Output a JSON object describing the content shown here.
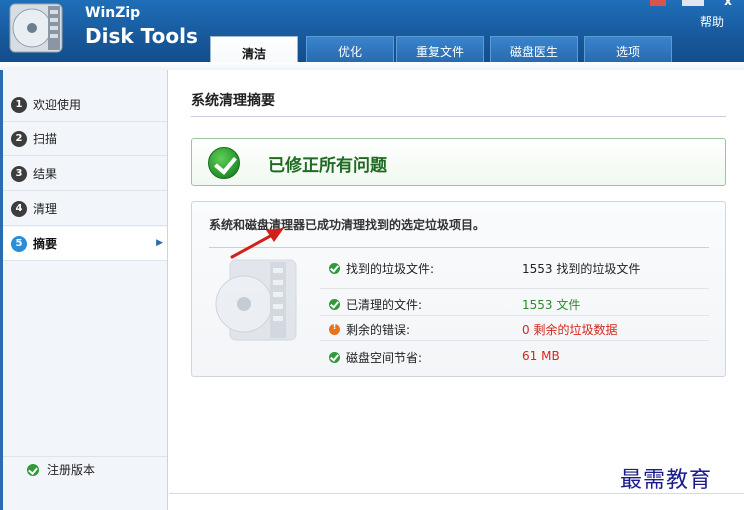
{
  "app": {
    "brand_top": "WinZip",
    "brand_main": "Disk Tools",
    "help_label": "帮助",
    "close_glyph": "x"
  },
  "tabs": [
    {
      "label": "清洁",
      "active": true
    },
    {
      "label": "优化",
      "active": false
    },
    {
      "label": "重复文件",
      "active": false
    },
    {
      "label": "磁盘医生",
      "active": false
    },
    {
      "label": "选项",
      "active": false
    }
  ],
  "sidebar": {
    "steps": [
      {
        "num": "1",
        "label": "欢迎使用",
        "active": false
      },
      {
        "num": "2",
        "label": "扫描",
        "active": false
      },
      {
        "num": "3",
        "label": "结果",
        "active": false
      },
      {
        "num": "4",
        "label": "清理",
        "active": false
      },
      {
        "num": "5",
        "label": "摘要",
        "active": true
      }
    ],
    "register_label": "注册版本",
    "active_chevron": "▶"
  },
  "main": {
    "title": "系统清理摘要",
    "success_message": "已修正所有问题",
    "description": "系统和磁盘清理器已成功清理找到的选定垃圾项目。",
    "stats": [
      {
        "icon": "check-icon",
        "label": "找到的垃圾文件:",
        "value": "1553 找到的垃圾文件",
        "value_color": "#222222"
      },
      {
        "icon": "check-icon",
        "label": "已清理的文件:",
        "value": "1553 文件",
        "value_color": "#2e8b2e"
      },
      {
        "icon": "warning-icon",
        "label": "剩余的错误:",
        "value": "0 剩余的垃圾数据",
        "value_color": "#d8261c"
      },
      {
        "icon": "check-icon",
        "label": "磁盘空间节省:",
        "value": "61 MB",
        "value_color": "#d8261c"
      }
    ]
  },
  "watermark": "最需教育",
  "colors": {
    "header": "#17589b",
    "success_green": "#1f6b21",
    "annotation_red": "#d0211a"
  }
}
